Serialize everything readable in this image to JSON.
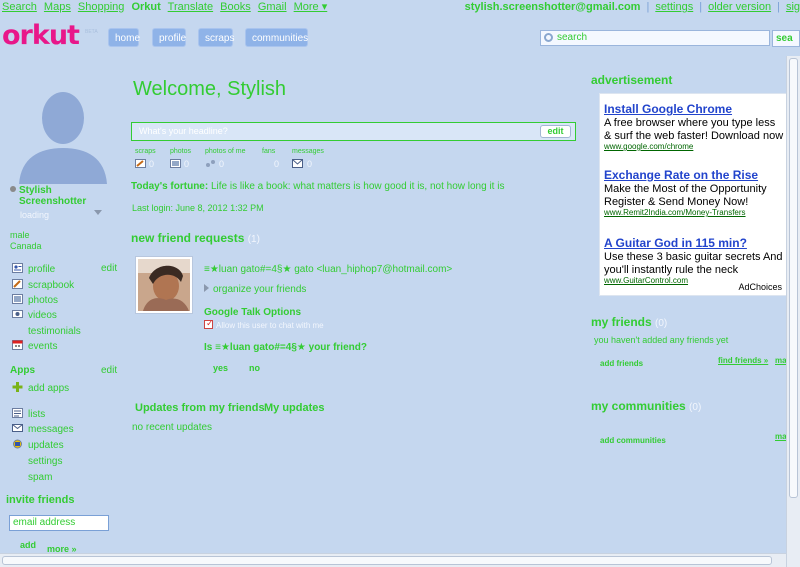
{
  "topbar": {
    "links": [
      "Search",
      "Maps",
      "Shopping",
      "Orkut",
      "Translate",
      "Books",
      "Gmail",
      "More ▾"
    ],
    "active": "Orkut",
    "email": "stylish.screenshotter@gmail.com",
    "settings": "settings",
    "older_version": "older version",
    "sign_out": "sig"
  },
  "header": {
    "logo": "orkut",
    "beta": "BETA",
    "nav": [
      "home",
      "profile",
      "scraps",
      "communities"
    ],
    "search_placeholder": "search",
    "search_button": "sea"
  },
  "profile": {
    "name": "Stylish Screenshotter",
    "status": "loading",
    "gender": "male",
    "country": "Canada",
    "edit_label": "edit"
  },
  "menu": [
    {
      "label": "profile",
      "icon": "profile-icon"
    },
    {
      "label": "scrapbook",
      "icon": "scrapbook-icon"
    },
    {
      "label": "photos",
      "icon": "photos-icon"
    },
    {
      "label": "videos",
      "icon": "videos-icon"
    },
    {
      "label": "testimonials",
      "icon": ""
    },
    {
      "label": "events",
      "icon": "calendar-icon"
    }
  ],
  "apps": {
    "heading": "Apps",
    "edit_label": "edit",
    "add_apps": "add apps"
  },
  "menu2": [
    {
      "label": "lists",
      "icon": "list-icon"
    },
    {
      "label": "messages",
      "icon": "mail-icon"
    },
    {
      "label": "updates",
      "icon": "updates-icon"
    },
    {
      "label": "settings",
      "icon": ""
    },
    {
      "label": "spam",
      "icon": ""
    }
  ],
  "invite": {
    "heading": "invite friends",
    "placeholder": "email address",
    "add": "add",
    "more": "more »"
  },
  "main": {
    "welcome": "Welcome, Stylish",
    "headline_placeholder": "What's your headline?",
    "headline_edit": "edit",
    "stats": [
      {
        "label": "scraps",
        "value": "0"
      },
      {
        "label": "photos",
        "value": "0"
      },
      {
        "label": "photos of me",
        "value": "0"
      },
      {
        "label": "fans",
        "value": "0"
      },
      {
        "label": "messages",
        "value": "0"
      }
    ],
    "fortune_label": "Today's fortune:",
    "fortune_text": "Life is like a book: what matters is how good it is, not how long it is",
    "last_login": "Last login: June 8, 2012 1:32 PM",
    "friend_requests_heading": "new friend requests",
    "friend_requests_count": "(1)",
    "request": {
      "name": "≡★luan gato#=4§★ gato",
      "email": "<luan_hiphop7@hotmail.com>",
      "organize": "organize your friends",
      "talk_heading": "Google Talk Options",
      "allow_chat": "Allow this user to chat with me",
      "question": "Is ≡★luan gato#=4§★ your friend?",
      "yes": "yes",
      "no": "no"
    },
    "tabs": [
      "Updates from my friends",
      "My updates"
    ],
    "no_updates": "no recent updates"
  },
  "right": {
    "ad_heading": "advertisement",
    "ads": [
      {
        "title": "Install Google Chrome",
        "text": "A free browser where you type less & surf the web faster! Download now",
        "url": "www.google.com/chrome"
      },
      {
        "title": "Exchange Rate on the Rise",
        "text": "Make the Most of the Opportunity Register & Send Money Now!",
        "url": "www.Remit2India.com/Money-Transfers"
      },
      {
        "title": "A Guitar God in 115 min?",
        "text": "Use these 3 basic guitar secrets And you'll instantly rule the neck",
        "url": "www.GuitarControl.com"
      }
    ],
    "adchoices": "AdChoices",
    "friends_heading": "my friends",
    "friends_count": "(0)",
    "friends_empty": "you haven't added any friends yet",
    "add_friends": "add friends",
    "find_friends": "find friends »",
    "friends_more": "ma",
    "communities_heading": "my communities",
    "communities_count": "(0)",
    "add_communities": "add communities",
    "communities_more": "ma"
  }
}
